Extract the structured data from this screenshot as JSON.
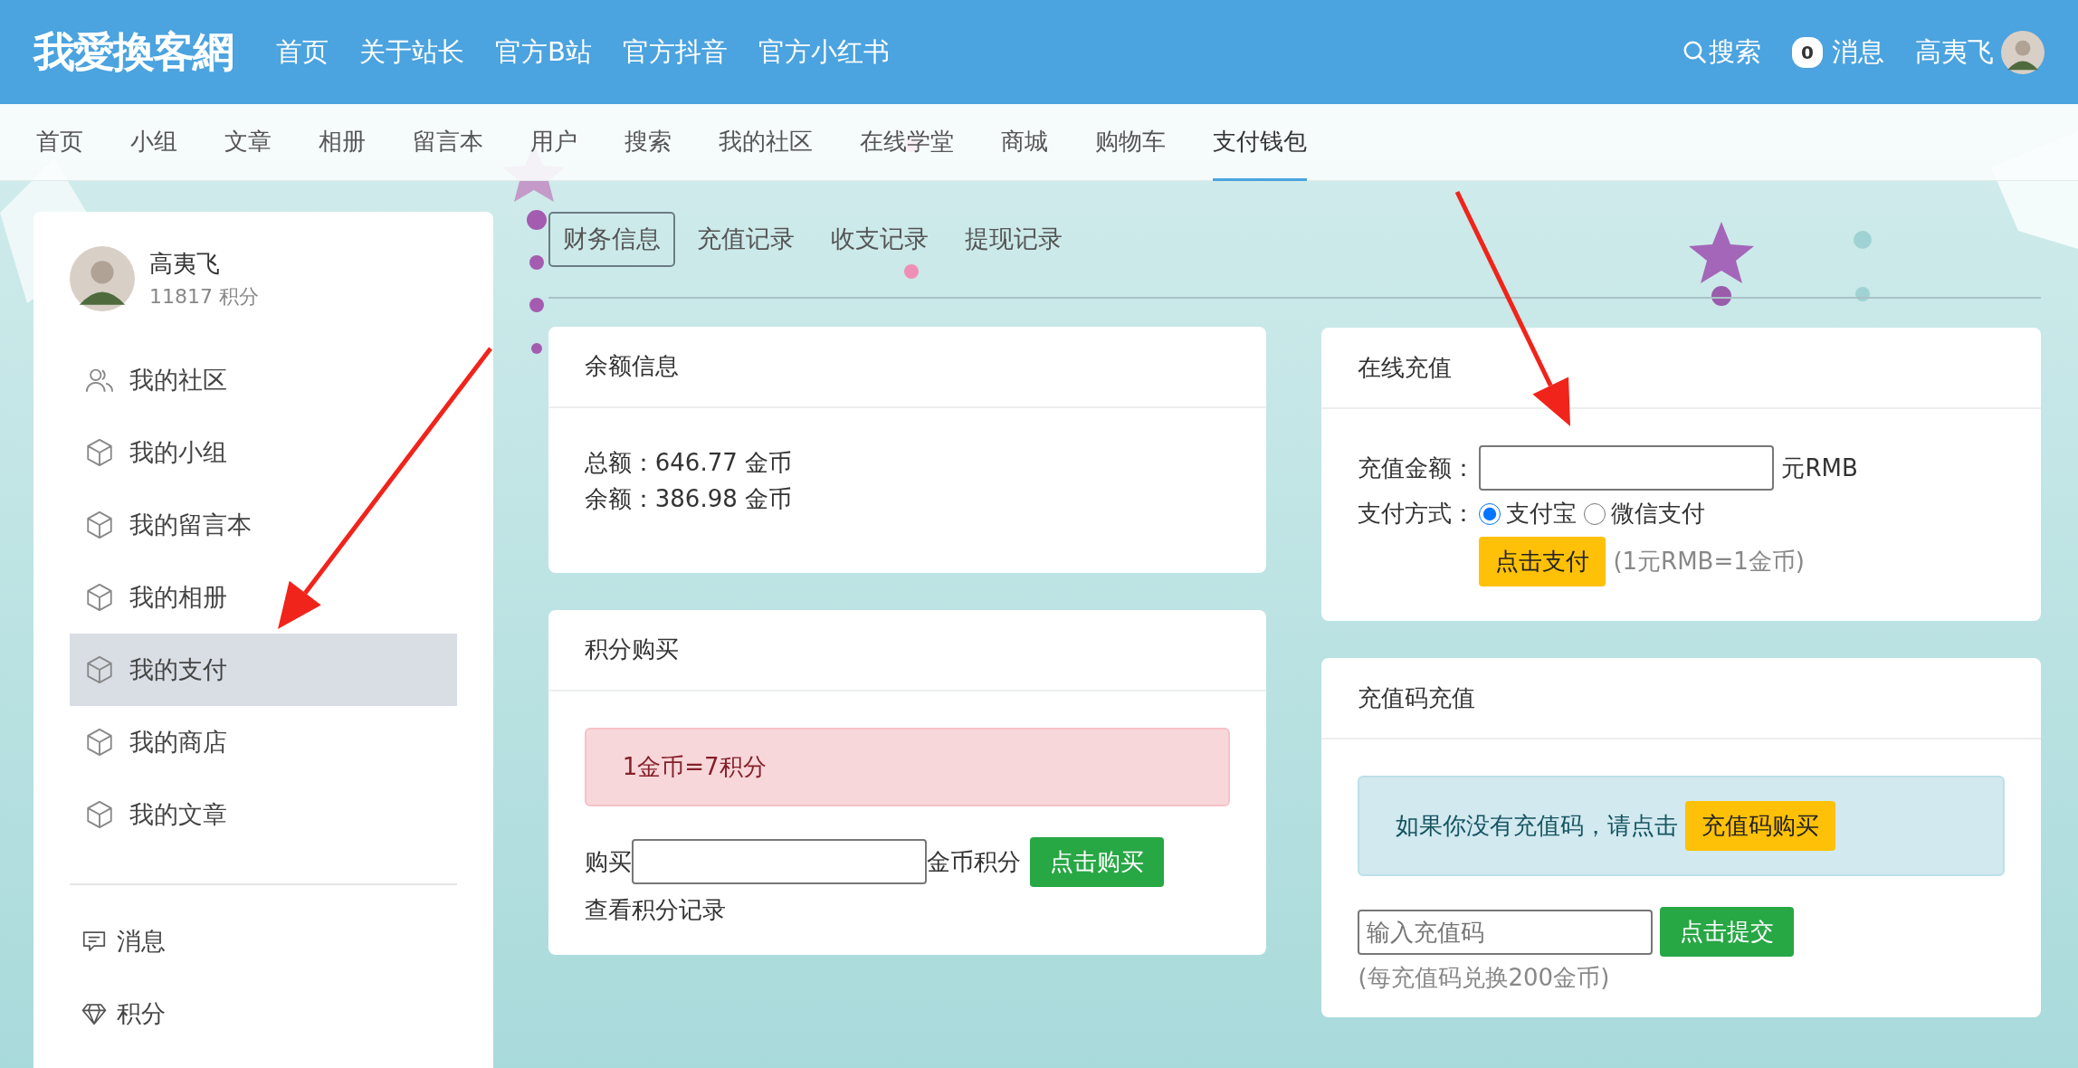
{
  "header": {
    "logo": "我愛換客網",
    "nav": [
      "首页",
      "关于站长",
      "官方B站",
      "官方抖音",
      "官方小红书"
    ],
    "search": "搜索",
    "messages": {
      "count": "0",
      "label": "消息"
    },
    "user": "高夷飞"
  },
  "subnav": [
    {
      "label": "首页",
      "selected": false
    },
    {
      "label": "小组",
      "selected": false
    },
    {
      "label": "文章",
      "selected": false
    },
    {
      "label": "相册",
      "selected": false
    },
    {
      "label": "留言本",
      "selected": false
    },
    {
      "label": "用户",
      "selected": false
    },
    {
      "label": "搜索",
      "selected": false
    },
    {
      "label": "我的社区",
      "selected": false
    },
    {
      "label": "在线学堂",
      "selected": false
    },
    {
      "label": "商城",
      "selected": false
    },
    {
      "label": "购物车",
      "selected": false
    },
    {
      "label": "支付钱包",
      "selected": true
    }
  ],
  "sidebar": {
    "user": {
      "name": "高夷飞",
      "points": "11817 积分"
    },
    "items": [
      {
        "label": "我的社区",
        "selected": false
      },
      {
        "label": "我的小组",
        "selected": false
      },
      {
        "label": "我的留言本",
        "selected": false
      },
      {
        "label": "我的相册",
        "selected": false
      },
      {
        "label": "我的支付",
        "selected": true
      },
      {
        "label": "我的商店",
        "selected": false
      },
      {
        "label": "我的文章",
        "selected": false
      }
    ],
    "extra_items": [
      {
        "label": "消息"
      },
      {
        "label": "积分"
      }
    ]
  },
  "tabs": [
    {
      "label": "财务信息",
      "selected": true
    },
    {
      "label": "充值记录",
      "selected": false
    },
    {
      "label": "收支记录",
      "selected": false
    },
    {
      "label": "提现记录",
      "selected": false
    }
  ],
  "balance_card": {
    "title": "余额信息",
    "lines": [
      "总额：646.77 金币",
      "余额：386.98 金币"
    ]
  },
  "points_card": {
    "title": "积分购买",
    "alert": "1金币=7积分",
    "prefix": "购买",
    "suffix": "金币积分",
    "button": "点击购买",
    "link": "查看积分记录"
  },
  "online_card": {
    "title": "在线充值",
    "amount_label": "充值金额：",
    "unit": "元RMB",
    "method_label": "支付方式：",
    "methods": [
      {
        "label": "支付宝",
        "selected": true
      },
      {
        "label": "微信支付",
        "selected": false
      }
    ],
    "button": "点击支付",
    "note": "(1元RMB=1金币)"
  },
  "code_card": {
    "title": "充值码充值",
    "info": "如果你没有充值码，请点击",
    "info_button": "充值码购买",
    "placeholder": "输入充值码",
    "button": "点击提交",
    "note": "(每充值码兑换200金币)"
  },
  "annotations": [
    {
      "kind": "arrow"
    },
    {
      "kind": "arrow"
    }
  ]
}
